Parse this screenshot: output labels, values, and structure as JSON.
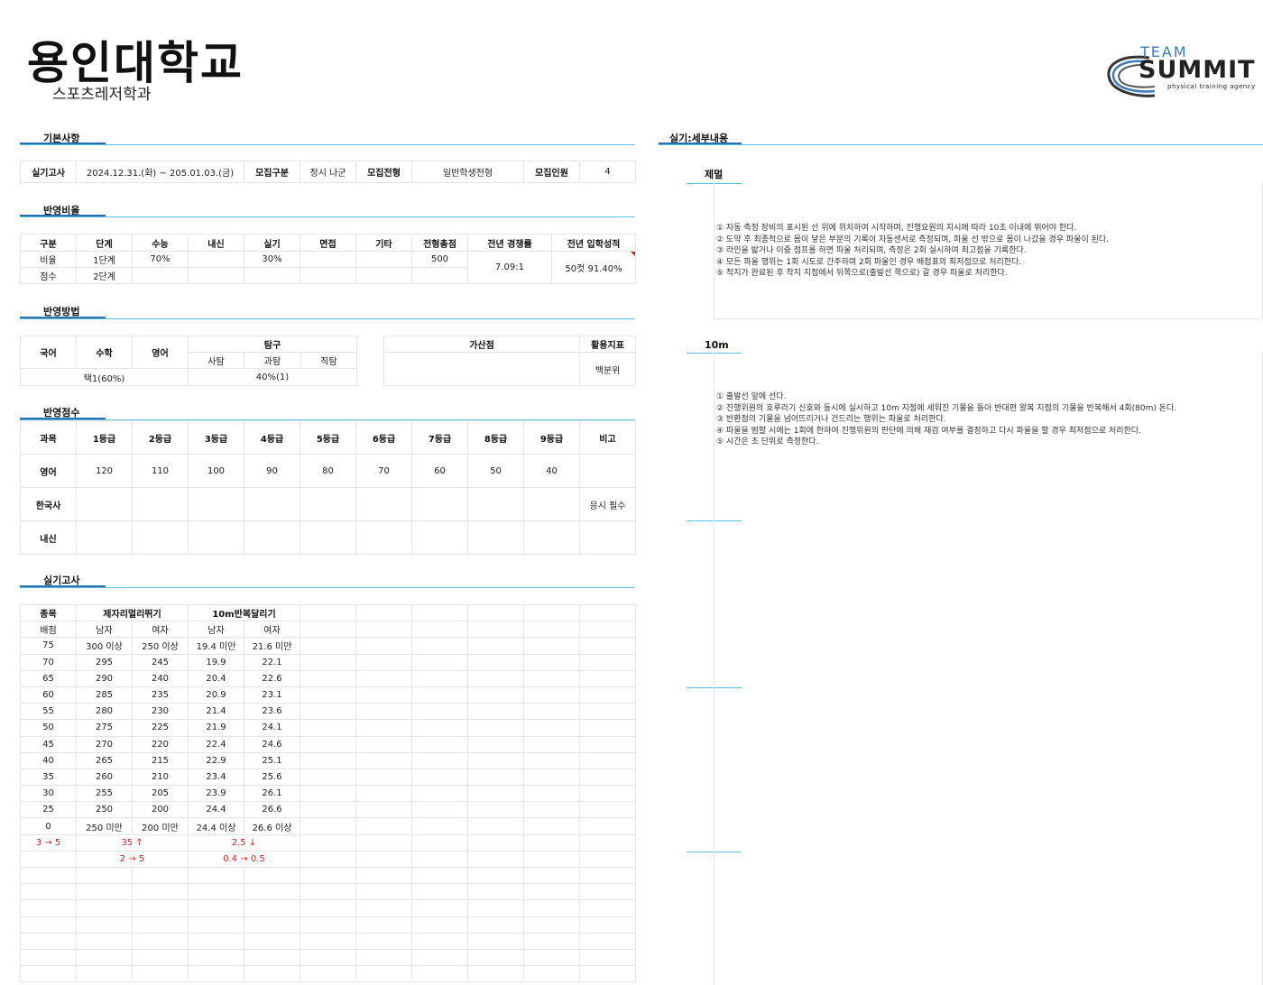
{
  "header": {
    "school": "용인대학교",
    "department": "스포츠레저학과",
    "logo": {
      "line1": "TEAM",
      "line2": "SUMMIT",
      "line3": "physical training agency"
    }
  },
  "basic": {
    "title": "기본사항",
    "cells": [
      "실기고사",
      "2024.12.31.(화) ~ 205.01.03.(금)",
      "모집구분",
      "정시 나군",
      "모집전형",
      "일반학생전형",
      "모집인원",
      "4"
    ]
  },
  "ratio": {
    "title": "반영비율",
    "headers": [
      "구분",
      "단계",
      "수능",
      "내신",
      "실기",
      "면접",
      "기타",
      "전형총점",
      "전년 경쟁률",
      "전년 입학성적"
    ],
    "row1": [
      "비율",
      "1단계",
      "70%",
      "",
      "30%",
      "",
      "",
      "500"
    ],
    "row2": [
      "점수",
      "2단계",
      "",
      "",
      "",
      "",
      "",
      ""
    ],
    "competition": "7.09:1",
    "admission": "50컷 91.40%"
  },
  "method": {
    "title": "반영방법",
    "korean": "국어",
    "math": "수학",
    "english": "영어",
    "tamgu": "탐구",
    "sub": [
      "사탐",
      "과탐",
      "직탐"
    ],
    "choice": "택1(60%)",
    "tamgu_val": "40%(1)",
    "bonus": "가산점",
    "index": "활용지표",
    "index_val": "백분위"
  },
  "score": {
    "title": "반영점수",
    "headers": [
      "과목",
      "1등급",
      "2등급",
      "3등급",
      "4등급",
      "5등급",
      "6등급",
      "7등급",
      "8등급",
      "9등급",
      "비고"
    ],
    "rows": [
      [
        "영어",
        "120",
        "110",
        "100",
        "90",
        "80",
        "70",
        "60",
        "50",
        "40",
        ""
      ],
      [
        "한국사",
        "",
        "",
        "",
        "",
        "",
        "",
        "",
        "",
        "",
        "응시 필수"
      ],
      [
        "내신",
        "",
        "",
        "",
        "",
        "",
        "",
        "",
        "",
        "",
        ""
      ]
    ]
  },
  "practical": {
    "title": "실기고사",
    "h1": [
      "종목",
      "제자리멀리뛰기",
      "10m반복달리기"
    ],
    "h2": [
      "배점",
      "남자",
      "여자",
      "남자",
      "여자"
    ],
    "rows": [
      [
        "75",
        "300 이상",
        "250 이상",
        "19.4 미만",
        "21.6 미만"
      ],
      [
        "70",
        "295",
        "245",
        "19.9",
        "22.1"
      ],
      [
        "65",
        "290",
        "240",
        "20.4",
        "22.6"
      ],
      [
        "60",
        "285",
        "235",
        "20.9",
        "23.1"
      ],
      [
        "55",
        "280",
        "230",
        "21.4",
        "23.6"
      ],
      [
        "50",
        "275",
        "225",
        "21.9",
        "24.1"
      ],
      [
        "45",
        "270",
        "220",
        "22.4",
        "24.6"
      ],
      [
        "40",
        "265",
        "215",
        "22.9",
        "25.1"
      ],
      [
        "35",
        "260",
        "210",
        "23.4",
        "25.6"
      ],
      [
        "30",
        "255",
        "205",
        "23.9",
        "26.1"
      ],
      [
        "25",
        "250",
        "200",
        "24.4",
        "26.6"
      ],
      [
        "0",
        "250 미만",
        "200 미만",
        "24.4 이상",
        "26.6 이상"
      ]
    ],
    "note1": [
      "3 → 5",
      "35 ↑",
      "2.5 ↓"
    ],
    "note2": [
      "2 → 5",
      "0.4 → 0.5"
    ]
  },
  "detail": {
    "title": "실기:세부내용",
    "jump": {
      "title": "제멀",
      "lines": [
        "① 자동 측정 장비의 표시된 선 위에 위치하여 시작하며, 진행요원의 지시에 따라 10초 이내에 뛰어야 한다.",
        "② 도약 후 최종적으로 몸이 닿은 부분의 기록이 자동센서로 측정되며, 파울 선 밖으로 몸이 나갔을 경우 파울이 된다.",
        "③ 라인을 밟거나 이중 점프를 하면 파울 처리되며, 측정은 2회 실시하여 최고점을 기록한다.",
        "④ 모든 파울 행위는 1회 시도로 간주하며 2회 파울인 경우 배점표의 최저점으로 처리한다.",
        "⑤ 착지가 완료된 후 착지 지점에서 뒤쪽으로(출발선 쪽으로) 갈 경우 파울로 처리한다."
      ]
    },
    "run": {
      "title": "10m",
      "lines": [
        "① 출발선 앞에 선다.",
        "② 진행위원의 호루라기 신호와 동시에 실시하고 10m 지점에 세워진 기물을 돌아 반대편 왕복 지점의 기물을 반복해서 4회(80m) 돈다.",
        "③ 반환점의 기물을 넘어뜨리거나 건드리는 행위는 파울로 처리한다.",
        "④ 파울을 범할 시에는 1회에 한하여 진행위원의 판단에 의해 재검 여부를 결정하고 다시 파울을 할 경우 최저점으로 처리한다.",
        "⑤ 시간은 초 단위로 측정한다."
      ]
    }
  },
  "colors": {
    "accent": "#5bc0de",
    "red": "#e02020"
  }
}
